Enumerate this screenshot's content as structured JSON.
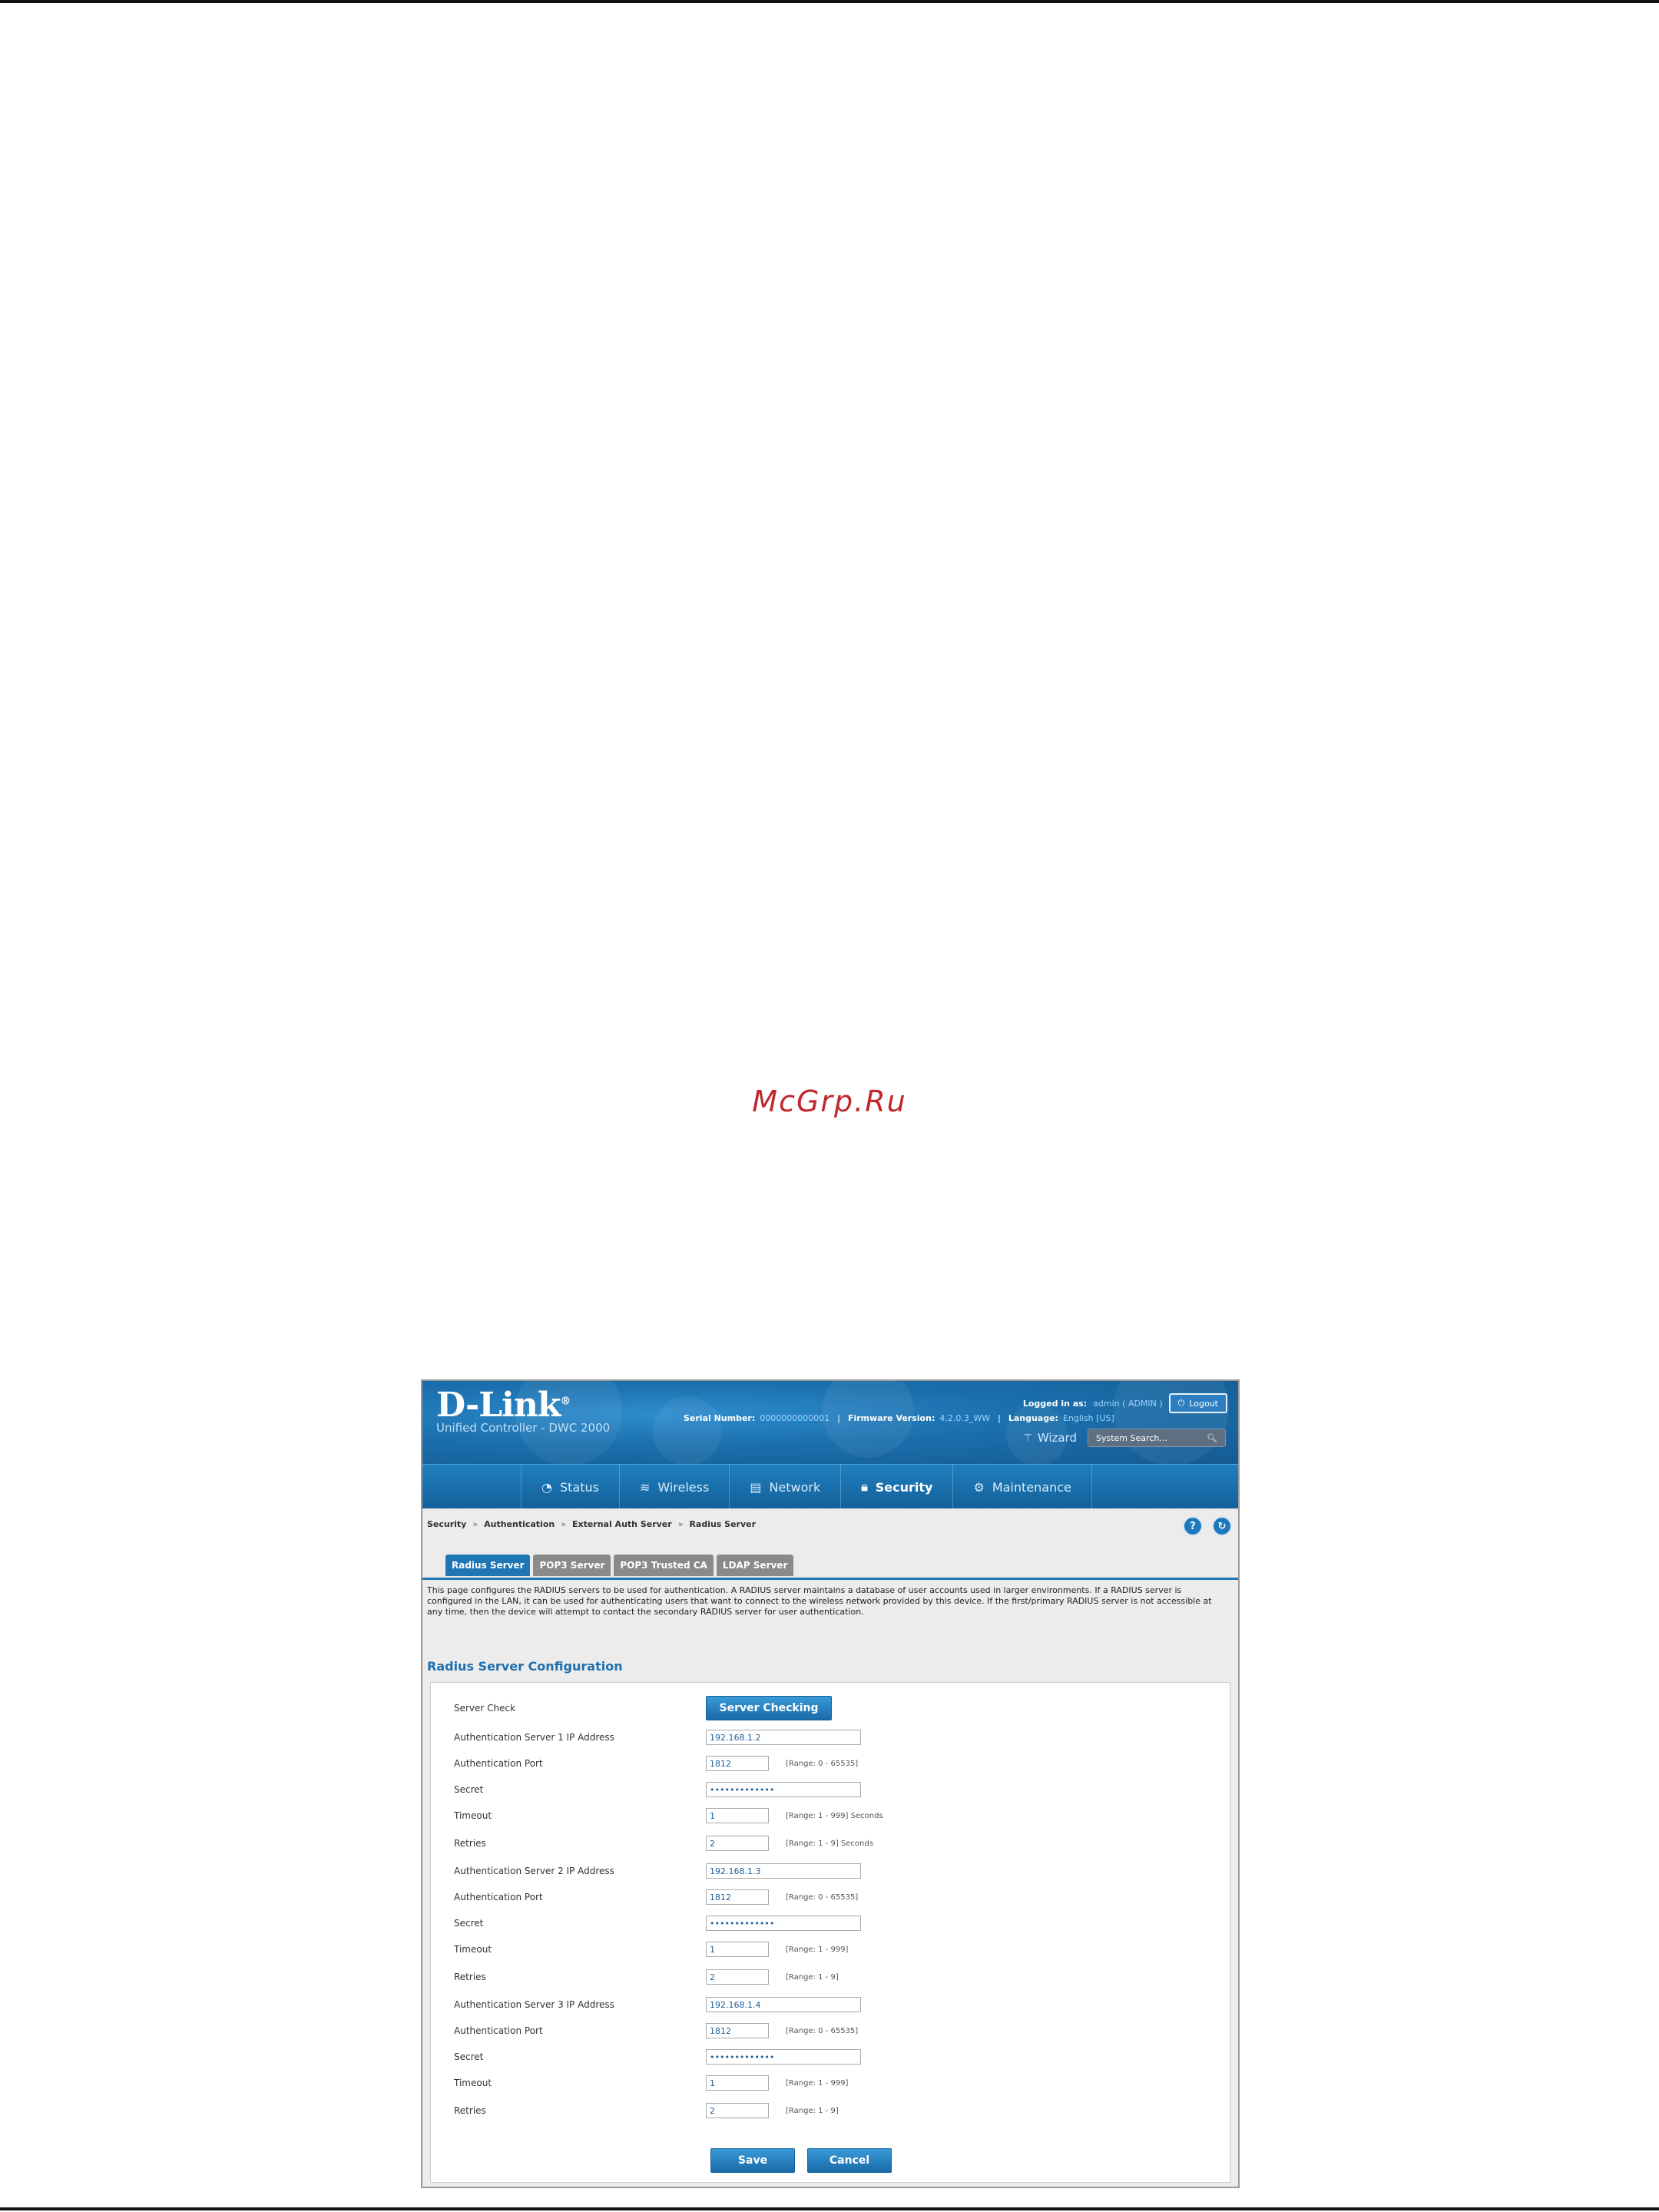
{
  "watermark": "McGrp.Ru",
  "header": {
    "logo": "D-Link",
    "logo_mark": "®",
    "subtitle": "Unified Controller - DWC 2000",
    "logged_in_label": "Logged in as:",
    "logged_in_value": "admin ( ADMIN )",
    "logout_label": "Logout",
    "serial_label": "Serial Number:",
    "serial_value": "0000000000001",
    "firmware_label": "Firmware Version:",
    "firmware_value": "4.2.0.3_WW",
    "language_label": "Language:",
    "language_value": "English [US]",
    "wizard_label": "Wizard",
    "search_placeholder": "System Search..."
  },
  "nav": {
    "items": [
      {
        "label": "Status",
        "icon": "gauge-icon"
      },
      {
        "label": "Wireless",
        "icon": "wifi-icon"
      },
      {
        "label": "Network",
        "icon": "network-icon"
      },
      {
        "label": "Security",
        "icon": "lock-icon",
        "active": true
      },
      {
        "label": "Maintenance",
        "icon": "gears-icon"
      }
    ]
  },
  "breadcrumb": [
    "Security",
    "Authentication",
    "External Auth Server",
    "Radius Server"
  ],
  "breadcrumb_sep": "»",
  "tabs": [
    {
      "label": "Radius Server",
      "active": true
    },
    {
      "label": "POP3 Server"
    },
    {
      "label": "POP3 Trusted CA"
    },
    {
      "label": "LDAP Server"
    }
  ],
  "description": "This page configures the RADIUS servers to be used for authentication. A RADIUS server maintains a database of user accounts used in larger environments. If a RADIUS server is configured in the LAN, it can be used for authenticating users that want to connect to the wireless network provided by this device. If the first/primary RADIUS server is not accessible at any time, then the device will attempt to contact the secondary RADIUS server for user authentication.",
  "section_title": "Radius Server Configuration",
  "form": {
    "server_check_label": "Server Check",
    "server_check_button": "Server Checking",
    "servers": [
      {
        "ip_label": "Authentication Server 1 IP Address",
        "ip": "192.168.1.2",
        "port_label": "Authentication Port",
        "port": "1812",
        "port_hint": "[Range: 0 - 65535]",
        "secret_label": "Secret",
        "secret": "•••••••••••••",
        "timeout_label": "Timeout",
        "timeout": "1",
        "timeout_hint": "[Range: 1 - 999] Seconds",
        "retries_label": "Retries",
        "retries": "2",
        "retries_hint": "[Range: 1 - 9] Seconds"
      },
      {
        "ip_label": "Authentication Server 2 IP Address",
        "ip": "192.168.1.3",
        "port_label": "Authentication Port",
        "port": "1812",
        "port_hint": "[Range: 0 - 65535]",
        "secret_label": "Secret",
        "secret": "•••••••••••••",
        "timeout_label": "Timeout",
        "timeout": "1",
        "timeout_hint": "[Range: 1 - 999]",
        "retries_label": "Retries",
        "retries": "2",
        "retries_hint": "[Range: 1 - 9]"
      },
      {
        "ip_label": "Authentication Server 3 IP Address",
        "ip": "192.168.1.4",
        "port_label": "Authentication Port",
        "port": "1812",
        "port_hint": "[Range: 0 - 65535]",
        "secret_label": "Secret",
        "secret": "•••••••••••••",
        "timeout_label": "Timeout",
        "timeout": "1",
        "timeout_hint": "[Range: 1 - 999]",
        "retries_label": "Retries",
        "retries": "2",
        "retries_hint": "[Range: 1 - 9]"
      }
    ],
    "save_label": "Save",
    "cancel_label": "Cancel"
  }
}
